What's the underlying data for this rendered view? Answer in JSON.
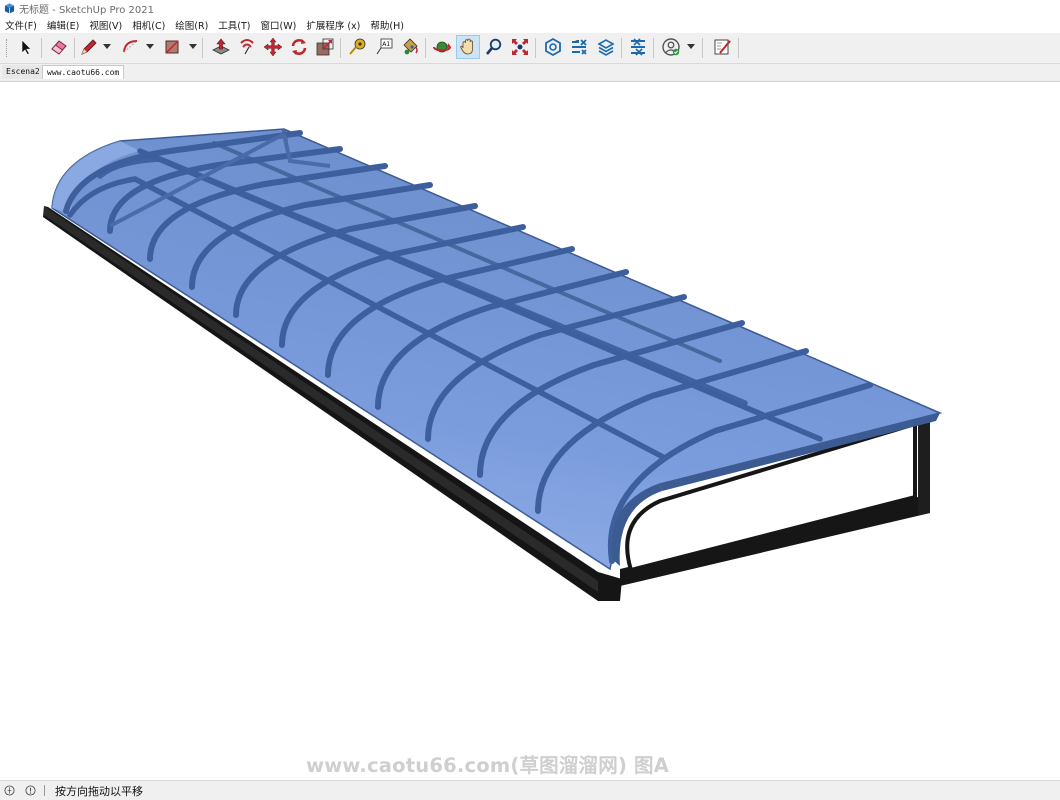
{
  "window": {
    "title": "无标题 - SketchUp Pro 2021"
  },
  "menu": {
    "items": [
      "文件(F)",
      "编辑(E)",
      "视图(V)",
      "相机(C)",
      "绘图(R)",
      "工具(T)",
      "窗口(W)",
      "扩展程序 (x)",
      "帮助(H)"
    ]
  },
  "toolbar": {
    "tools": [
      {
        "name": "select-tool",
        "icon": "cursor-arrow-icon"
      },
      {
        "name": "eraser-tool",
        "icon": "eraser-icon"
      },
      {
        "name": "line-tool",
        "icon": "pencil-icon",
        "dropdown": true
      },
      {
        "name": "arc-tool",
        "icon": "arc-icon",
        "dropdown": true
      },
      {
        "name": "rectangle-tool",
        "icon": "rectangle-icon",
        "dropdown": true
      },
      {
        "name": "push-pull-tool",
        "icon": "push-pull-icon"
      },
      {
        "name": "offset-tool",
        "icon": "offset-icon"
      },
      {
        "name": "move-tool",
        "icon": "move-icon"
      },
      {
        "name": "rotate-tool",
        "icon": "rotate-icon"
      },
      {
        "name": "scale-tool",
        "icon": "scale-icon"
      },
      {
        "name": "tape-measure-tool",
        "icon": "tape-measure-icon"
      },
      {
        "name": "text-tool",
        "icon": "text-label-icon"
      },
      {
        "name": "paint-bucket-tool",
        "icon": "paint-bucket-icon"
      },
      {
        "name": "orbit-tool",
        "icon": "orbit-icon"
      },
      {
        "name": "pan-tool",
        "icon": "hand-icon",
        "active": true
      },
      {
        "name": "zoom-tool",
        "icon": "magnifier-icon"
      },
      {
        "name": "zoom-extents-tool",
        "icon": "zoom-extents-icon"
      },
      {
        "name": "3d-warehouse-button",
        "icon": "warehouse-icon"
      },
      {
        "name": "extension-warehouse-button",
        "icon": "extension-warehouse-icon"
      },
      {
        "name": "layout-button",
        "icon": "layout-icon"
      },
      {
        "name": "extension-manager-button",
        "icon": "extension-manager-icon"
      },
      {
        "name": "account-button",
        "icon": "account-icon",
        "dropdown": true
      },
      {
        "name": "send-to-layout-button",
        "icon": "send-to-layout-icon"
      }
    ],
    "active_tool": "pan-tool"
  },
  "scenes": {
    "tabs": [
      "Escena2",
      "www.caotu66.com"
    ]
  },
  "viewport": {
    "watermark": "www.caotu66.com(草图溜溜网) 图A",
    "model": {
      "description_colors": {
        "glass": "#6f93d4",
        "glass_light": "#93b1e8",
        "frame_bars": "#3e5f9e",
        "frame": "#1a1a1a"
      }
    }
  },
  "status": {
    "message": "按方向拖动以平移"
  },
  "colors": {
    "accent_active_tool_bg": "#cce4f7",
    "accent_active_tool_border": "#99c9ef"
  }
}
